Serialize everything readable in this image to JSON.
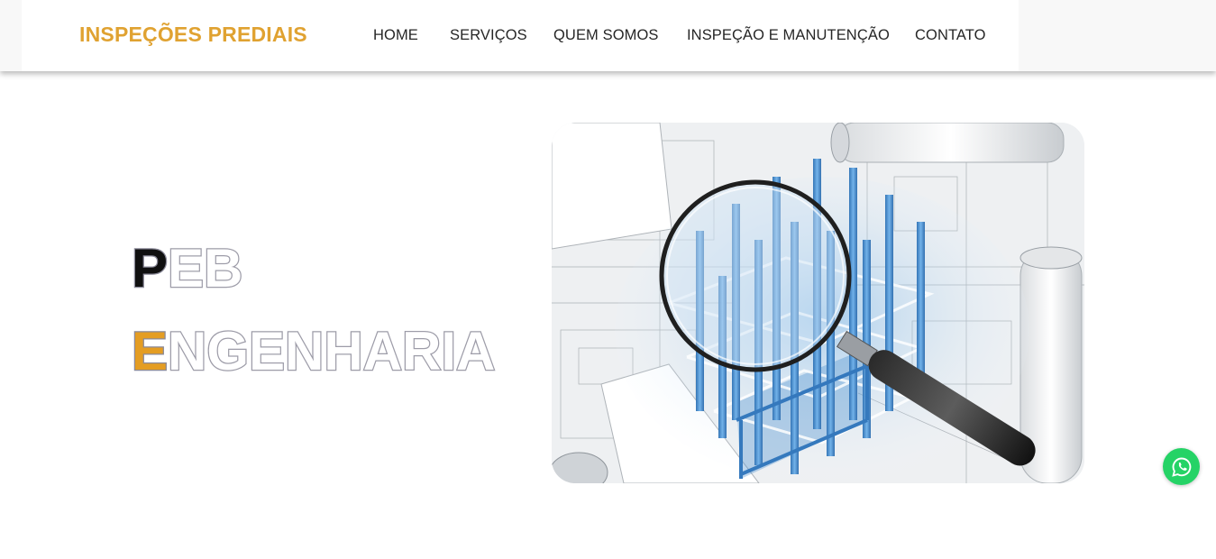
{
  "header": {
    "brand": "INSPEÇÕES PREDIAIS",
    "nav": [
      {
        "label": "HOME"
      },
      {
        "label": "SERVIÇOS"
      },
      {
        "label": "QUEM SOMOS"
      },
      {
        "label": "INSPEÇÃO E MANUTENÇÃO"
      },
      {
        "label": "CONTATO"
      }
    ]
  },
  "hero": {
    "line1_first": "P",
    "line1_rest": "EB",
    "line2_first": "E",
    "line2_rest": "NGENHARIA",
    "image_icon": "magnifier-over-building-blueprint"
  },
  "floating": {
    "whatsapp_icon": "whatsapp-icon"
  },
  "colors": {
    "brand_gold": "#e0a231",
    "accent_gold": "#e49d23",
    "outline_gray": "#9d9ca8",
    "whatsapp_green": "#25d366",
    "blueprint_blue": "#2f7fc6"
  }
}
